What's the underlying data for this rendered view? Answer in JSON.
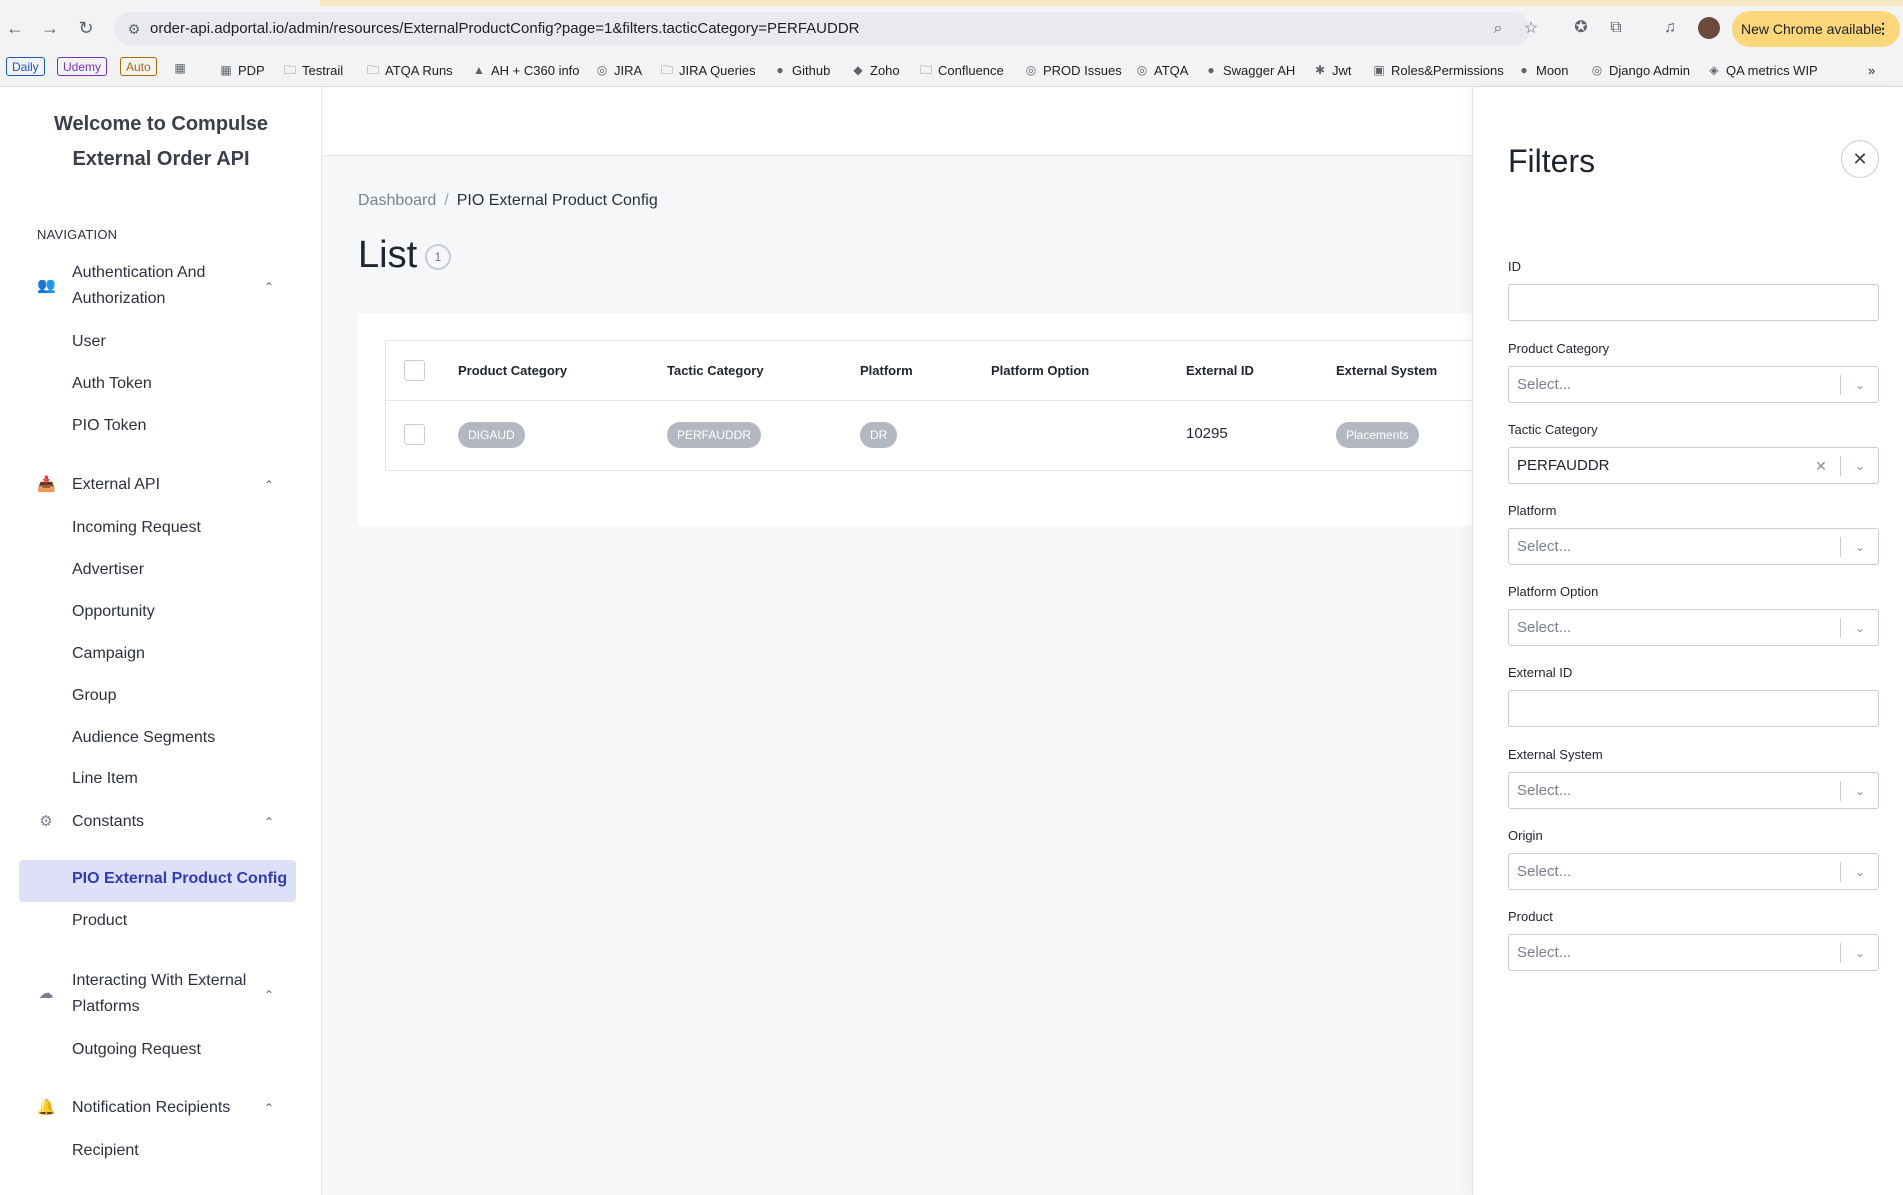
{
  "browser": {
    "url": "order-api.adportal.io/admin/resources/ExternalProductConfig?page=1&filters.tacticCategory=PERFAUDDR",
    "update_label": "New Chrome available",
    "update_menu": "⋮",
    "back_icon": "←",
    "forward_icon": "→",
    "reload_icon": "↻",
    "tune_icon": "⚙",
    "zoom_icon": "⌕",
    "star_icon": "☆",
    "overflow": "»"
  },
  "bookmarks": {
    "chips": [
      {
        "label": "Daily",
        "color": "#1a56c4"
      },
      {
        "label": "Udemy",
        "color": "#7b2fbe"
      },
      {
        "label": "Auto",
        "color": "#b06a00"
      }
    ],
    "items": [
      {
        "label": "PDP",
        "icon": "▦"
      },
      {
        "label": "Testrail",
        "icon": "🗀"
      },
      {
        "label": "ATQA Runs",
        "icon": "🗀"
      },
      {
        "label": "AH + C360 info",
        "icon": "▲"
      },
      {
        "label": "JIRA",
        "icon": "◎"
      },
      {
        "label": "JIRA Queries",
        "icon": "🗀"
      },
      {
        "label": "Github",
        "icon": "●"
      },
      {
        "label": "Zoho",
        "icon": "◆"
      },
      {
        "label": "Confluence",
        "icon": "🗀"
      },
      {
        "label": "PROD Issues",
        "icon": "◎"
      },
      {
        "label": "ATQA",
        "icon": "◎"
      },
      {
        "label": "Swagger AH",
        "icon": "●"
      },
      {
        "label": "Jwt",
        "icon": "✱"
      },
      {
        "label": "Roles&Permissions",
        "icon": "▣"
      },
      {
        "label": "Moon",
        "icon": "●"
      },
      {
        "label": "Django Admin",
        "icon": "◎"
      },
      {
        "label": "QA metrics WIP",
        "icon": "◈"
      }
    ]
  },
  "sidebar": {
    "welcome_line1": "Welcome to Compulse",
    "welcome_line2": "External Order API",
    "nav_heading": "NAVIGATION",
    "groups": [
      {
        "label_line1": "Authentication And",
        "label_line2": "Authorization",
        "icon": "👥",
        "items": [
          "User",
          "Auth Token",
          "PIO Token"
        ]
      },
      {
        "label_line1": "External API",
        "label_line2": "",
        "icon": "📥",
        "items": [
          "Incoming Request",
          "Advertiser",
          "Opportunity",
          "Campaign",
          "Group",
          "Audience Segments",
          "Line Item"
        ]
      },
      {
        "label_line1": "Constants",
        "label_line2": "",
        "icon": "⚙",
        "items": [
          "PIO External Product Config",
          "Product"
        ]
      },
      {
        "label_line1": "Interacting With External",
        "label_line2": "Platforms",
        "icon": "☁",
        "items": [
          "Outgoing Request"
        ]
      },
      {
        "label_line1": "Notification Recipients",
        "label_line2": "",
        "icon": "🔔",
        "items": [
          "Recipient"
        ]
      }
    ],
    "chevron": "⌃",
    "active_item": "PIO External Product Config"
  },
  "main": {
    "breadcrumb": {
      "root": "Dashboard",
      "separator": "/",
      "current": "PIO External Product Config"
    },
    "title": "List",
    "count": "1",
    "table": {
      "columns": [
        "Product Category",
        "Tactic Category",
        "Platform",
        "Platform Option",
        "External ID",
        "External System"
      ],
      "rows": [
        {
          "product_category": "DIGAUD",
          "tactic_category": "PERFAUDDR",
          "platform": "DR",
          "platform_option": "",
          "external_id": "10295",
          "external_system": "Placements"
        }
      ]
    }
  },
  "filters": {
    "title": "Filters",
    "close_icon": "✕",
    "fields": [
      {
        "label": "ID",
        "type": "input",
        "value": ""
      },
      {
        "label": "Product Category",
        "type": "select",
        "value": "Select..."
      },
      {
        "label": "Tactic Category",
        "type": "select",
        "value": "PERFAUDDR",
        "set": true
      },
      {
        "label": "Platform",
        "type": "select",
        "value": "Select..."
      },
      {
        "label": "Platform Option",
        "type": "select",
        "value": "Select..."
      },
      {
        "label": "External ID",
        "type": "input",
        "value": ""
      },
      {
        "label": "External System",
        "type": "select",
        "value": "Select..."
      },
      {
        "label": "Origin",
        "type": "select",
        "value": "Select..."
      },
      {
        "label": "Product",
        "type": "select",
        "value": "Select..."
      }
    ],
    "chevron_icon": "⌄",
    "clear_icon": "✕"
  }
}
